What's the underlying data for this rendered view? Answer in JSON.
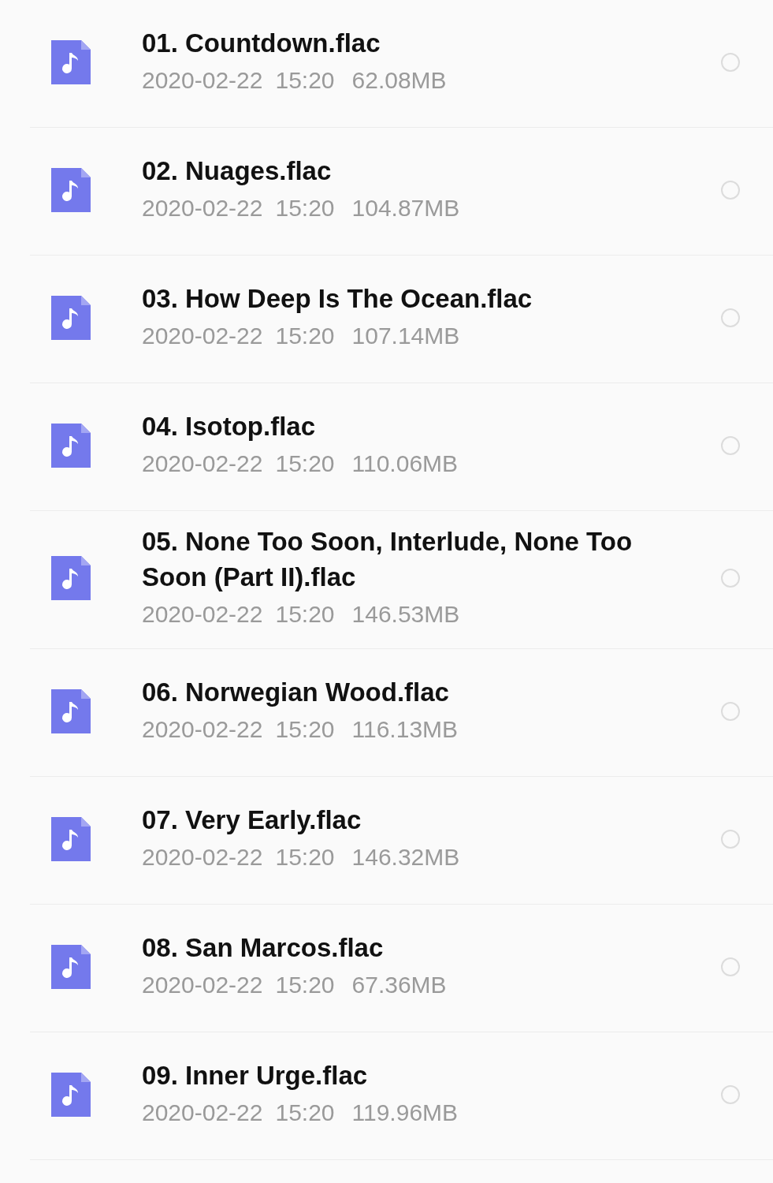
{
  "files": [
    {
      "name": "01. Countdown.flac",
      "date": "2020-02-22",
      "time": "15:20",
      "size": "62.08MB",
      "selected": false
    },
    {
      "name": "02. Nuages.flac",
      "date": "2020-02-22",
      "time": "15:20",
      "size": "104.87MB",
      "selected": false
    },
    {
      "name": "03. How Deep Is The Ocean.flac",
      "date": "2020-02-22",
      "time": "15:20",
      "size": "107.14MB",
      "selected": false
    },
    {
      "name": "04. Isotop.flac",
      "date": "2020-02-22",
      "time": "15:20",
      "size": "110.06MB",
      "selected": false
    },
    {
      "name": "05. None Too Soon, Interlude, None Too Soon (Part II).flac",
      "date": "2020-02-22",
      "time": "15:20",
      "size": "146.53MB",
      "selected": false
    },
    {
      "name": "06. Norwegian Wood.flac",
      "date": "2020-02-22",
      "time": "15:20",
      "size": "116.13MB",
      "selected": false
    },
    {
      "name": "07. Very Early.flac",
      "date": "2020-02-22",
      "time": "15:20",
      "size": "146.32MB",
      "selected": false
    },
    {
      "name": "08. San Marcos.flac",
      "date": "2020-02-22",
      "time": "15:20",
      "size": "67.36MB",
      "selected": false
    },
    {
      "name": "09. Inner Urge.flac",
      "date": "2020-02-22",
      "time": "15:20",
      "size": "119.96MB",
      "selected": false
    }
  ]
}
